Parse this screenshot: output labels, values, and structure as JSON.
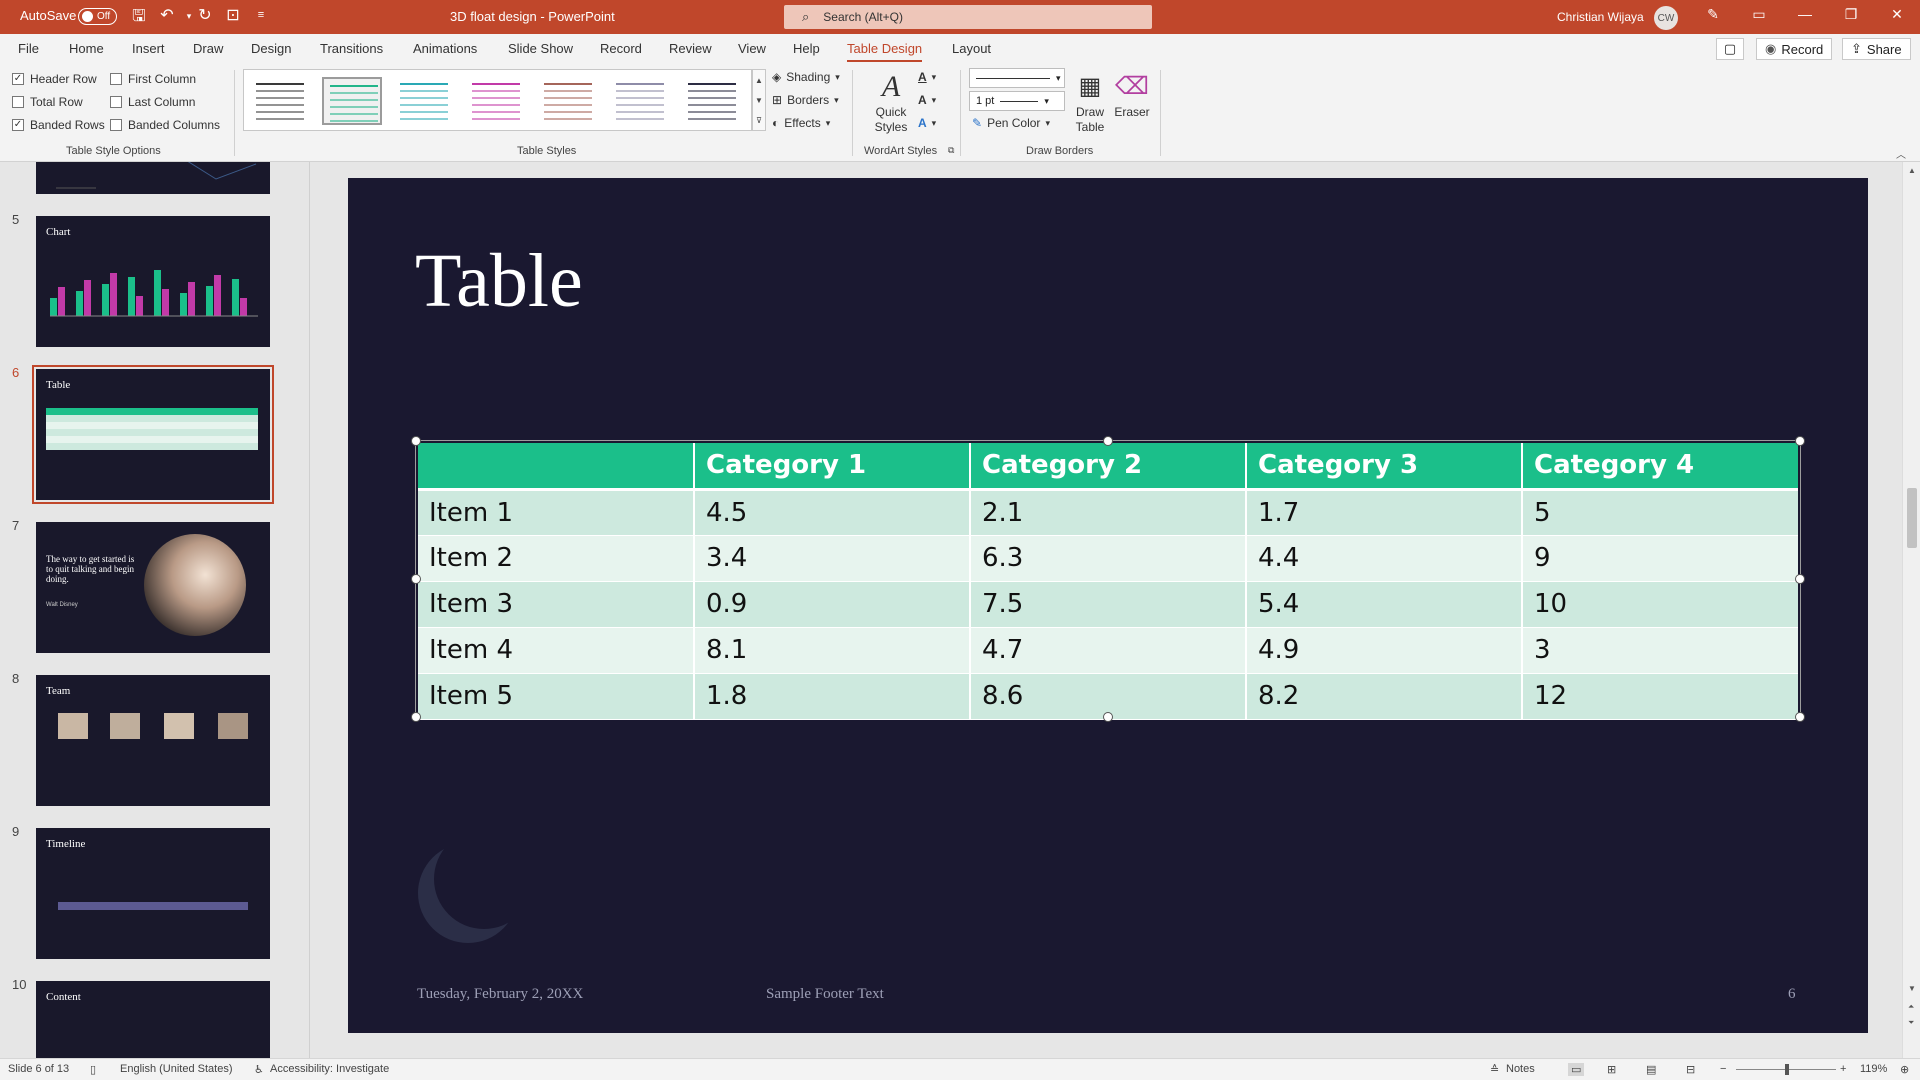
{
  "titlebar": {
    "autosave_label": "AutoSave",
    "autosave_state": "Off",
    "document_title": "3D float design  -  PowerPoint",
    "search_placeholder": "Search (Alt+Q)",
    "user_name": "Christian Wijaya",
    "user_initials": "CW"
  },
  "tabs": [
    "File",
    "Home",
    "Insert",
    "Draw",
    "Design",
    "Transitions",
    "Animations",
    "Slide Show",
    "Record",
    "Review",
    "View",
    "Help",
    "Table Design",
    "Layout"
  ],
  "active_tab": "Table Design",
  "ribbon_right": {
    "record": "Record",
    "share": "Share"
  },
  "table_style_options": {
    "header_row": {
      "label": "Header Row",
      "checked": true
    },
    "first_column": {
      "label": "First Column",
      "checked": false
    },
    "total_row": {
      "label": "Total Row",
      "checked": false
    },
    "last_column": {
      "label": "Last Column",
      "checked": false
    },
    "banded_rows": {
      "label": "Banded Rows",
      "checked": true
    },
    "banded_columns": {
      "label": "Banded Columns",
      "checked": false
    },
    "group_label": "Table Style Options"
  },
  "table_styles": {
    "group_label": "Table Styles",
    "swatches": [
      "#3a3a3a",
      "#22b58a",
      "#2aa9b5",
      "#c23aa8",
      "#a5655a",
      "#8e8ca8",
      "#2d2d44"
    ],
    "selected_index": 1,
    "shading": "Shading",
    "borders": "Borders",
    "effects": "Effects"
  },
  "wordart": {
    "quick_styles_line1": "Quick",
    "quick_styles_line2": "Styles",
    "group_label": "WordArt Styles"
  },
  "draw_borders": {
    "pen_weight": "1 pt",
    "pen_color": "Pen Color",
    "draw_table_line1": "Draw",
    "draw_table_line2": "Table",
    "eraser": "Eraser",
    "group_label": "Draw Borders"
  },
  "slides_panel": [
    {
      "number": "5",
      "title": "Chart"
    },
    {
      "number": "6",
      "title": "Table"
    },
    {
      "number": "7",
      "quote": "The way to get started is to quit talking and begin doing.",
      "author": "Walt Disney"
    },
    {
      "number": "8",
      "title": "Team"
    },
    {
      "number": "9",
      "title": "Timeline"
    },
    {
      "number": "10",
      "title": "Content"
    }
  ],
  "slide": {
    "title": "Table",
    "footer_date": "Tuesday, February 2, 20XX",
    "footer_text": "Sample Footer Text",
    "page_number": "6",
    "table": {
      "headers": [
        "",
        "Category 1",
        "Category 2",
        "Category 3",
        "Category 4"
      ],
      "rows": [
        [
          "Item 1",
          "4.5",
          "2.1",
          "1.7",
          "5"
        ],
        [
          "Item 2",
          "3.4",
          "6.3",
          "4.4",
          "9"
        ],
        [
          "Item 3",
          "0.9",
          "7.5",
          "5.4",
          "10"
        ],
        [
          "Item 4",
          "8.1",
          "4.7",
          "4.9",
          "3"
        ],
        [
          "Item 5",
          "1.8",
          "8.6",
          "8.2",
          "12"
        ]
      ]
    }
  },
  "statusbar": {
    "slide_counter": "Slide 6 of 13",
    "language": "English (United States)",
    "accessibility": "Accessibility: Investigate",
    "notes": "Notes",
    "zoom": "119%"
  }
}
